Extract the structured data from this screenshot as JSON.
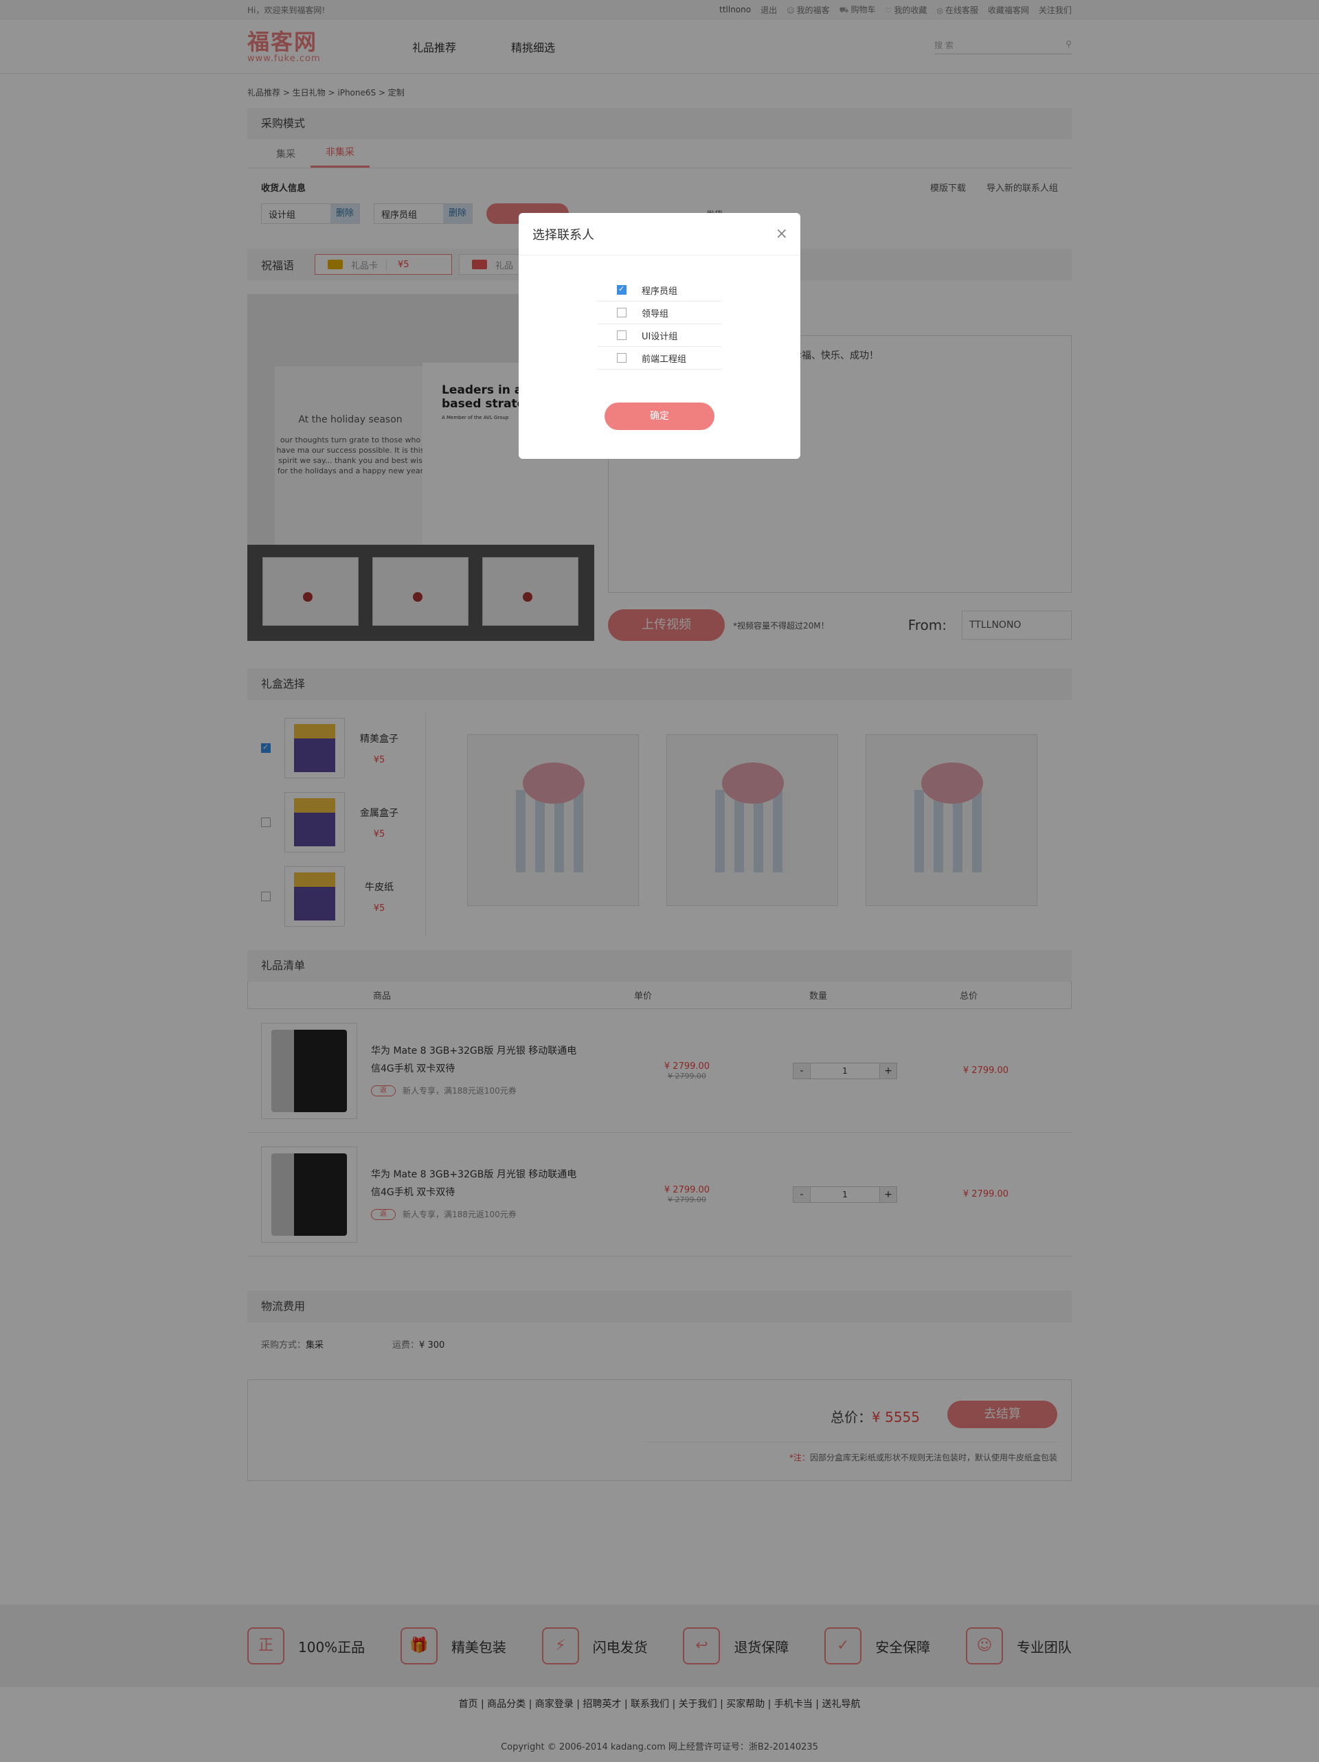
{
  "topbar": {
    "welcome": "Hi，欢迎来到福客网!",
    "username": "ttllnono",
    "logout": "退出",
    "links": [
      "我的福客",
      "购物车",
      "我的收藏",
      "在线客服",
      "收藏福客网",
      "关注我们"
    ]
  },
  "header": {
    "logo_name": "福客网",
    "logo_url": "www.fuke.com",
    "nav": [
      "礼品推荐",
      "精挑细选"
    ],
    "search_placeholder": "搜 索"
  },
  "breadcrumb": "礼品推荐 > 生日礼物 > iPhone6S > 定制",
  "purchase": {
    "title": "采购模式",
    "tabs": [
      "集采",
      "非集采"
    ],
    "receiver_label": "收货人信息",
    "template_download": "模版下载",
    "import_group": "导入新的联系人组",
    "groups": [
      {
        "name": "设计组",
        "delete": "删除"
      },
      {
        "name": "程序员组",
        "delete": "删除"
      }
    ],
    "ship_text": "发货"
  },
  "blessing": {
    "title": "祝福语",
    "card_label": "礼品卡",
    "card_price": "¥5",
    "card2_label": "礼品"
  },
  "card_photo": {
    "left_text": "At the holiday season",
    "left_small": "our thoughts turn grate to those who have ma our success possible. It is this spirit we say... thank you and best wis for the holidays and a happy new year",
    "right_title": "Leaders in ana based strateg",
    "right_sub": "A Member of the AVL Group"
  },
  "message": {
    "text": "真诚地祝你幸福、快乐、成功！",
    "upload": "上传视频",
    "upload_note": "*视频容量不得超过20M！",
    "from_label": "From:",
    "from_value": "TTLLNONO"
  },
  "giftbox": {
    "title": "礼盒选择",
    "items": [
      {
        "name": "精美盒子",
        "price": "¥5",
        "checked": true
      },
      {
        "name": "金属盒子",
        "price": "¥5",
        "checked": false
      },
      {
        "name": "牛皮纸",
        "price": "¥5",
        "checked": false
      }
    ]
  },
  "giftlist": {
    "title": "礼品清单",
    "headers": [
      "商品",
      "单价",
      "数量",
      "总价"
    ],
    "rows": [
      {
        "name": "华为 Mate 8 3GB+32GB版 月光银 移动联通电信4G手机 双卡双待",
        "promo_tag": "返",
        "promo": "新人专享，满188元返100元券",
        "price": "¥ 2799.00",
        "old_price": "¥ 2799.00",
        "minus": "-",
        "qty": "1",
        "plus": "+",
        "total": "¥ 2799.00"
      },
      {
        "name": "华为 Mate 8 3GB+32GB版 月光银 移动联通电信4G手机 双卡双待",
        "promo_tag": "返",
        "promo": "新人专享，满188元返100元券",
        "price": "¥ 2799.00",
        "old_price": "¥ 2799.00",
        "minus": "-",
        "qty": "1",
        "plus": "+",
        "total": "¥ 2799.00"
      }
    ]
  },
  "logistics": {
    "title": "物流费用",
    "mode_label": "采购方式：",
    "mode_value": "集采",
    "fee_label": "运费：",
    "fee_value": "¥ 300"
  },
  "summary": {
    "total_label": "总价：",
    "total_value": "¥ 5555",
    "checkout": "去结算",
    "note_prefix": "*注：",
    "note": "因部分盒库无彩纸或形状不规则无法包装时，默认使用牛皮纸盒包装"
  },
  "features": [
    {
      "icon": "正",
      "label": "100%正品"
    },
    {
      "icon": "🎁",
      "label": "精美包装"
    },
    {
      "icon": "⚡",
      "label": "闪电发货"
    },
    {
      "icon": "↩",
      "label": "退货保障"
    },
    {
      "icon": "✓",
      "label": "安全保障"
    },
    {
      "icon": "☺",
      "label": "专业团队"
    }
  ],
  "footer": {
    "links": "首页 | 商品分类 | 商家登录 | 招聘英才 | 联系我们 | 关于我们 | 买家帮助 | 手机卡当 | 送礼导航",
    "copyright": "Copyright © 2006-2014 kadang.com 网上经营许可证号：浙B2-20140235"
  },
  "modal": {
    "title": "选择联系人",
    "close": "×",
    "options": [
      {
        "label": "程序员组",
        "checked": true
      },
      {
        "label": "领导组",
        "checked": false
      },
      {
        "label": "UI设计组",
        "checked": false
      },
      {
        "label": "前端工程组",
        "checked": false
      }
    ],
    "confirm": "确定"
  },
  "colors": {
    "accent": "#f08080",
    "price": "#e44444",
    "checkbox": "#3a8ee6"
  }
}
